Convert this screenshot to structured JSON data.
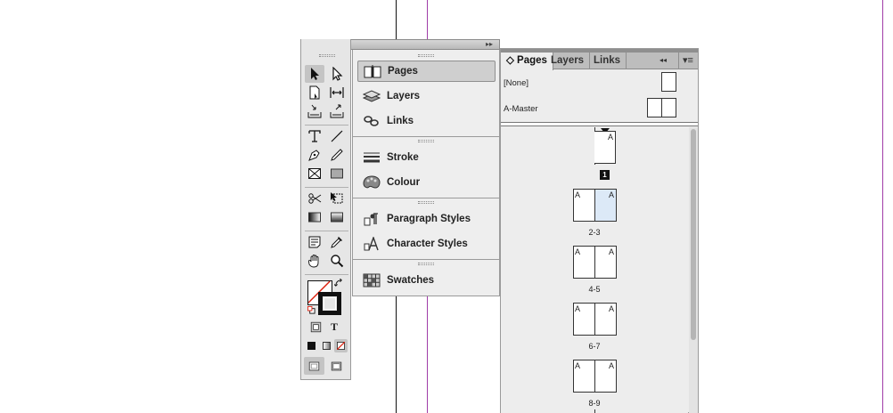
{
  "tools_panel": {
    "close_glyph": "×",
    "collapse_glyph": "◂◂",
    "expand_glyph": "▸▸",
    "tools": [
      {
        "name": "selection-tool-icon"
      },
      {
        "name": "direct-selection-tool-icon"
      },
      {
        "name": "page-tool-icon"
      },
      {
        "name": "gap-tool-icon"
      },
      {
        "name": "content-collector-icon"
      },
      {
        "name": "content-placer-icon"
      },
      {
        "name": "type-tool-icon"
      },
      {
        "name": "line-tool-icon"
      },
      {
        "name": "pen-tool-icon"
      },
      {
        "name": "pencil-tool-icon"
      },
      {
        "name": "rectangle-frame-tool-icon"
      },
      {
        "name": "rectangle-tool-icon"
      },
      {
        "name": "scissors-tool-icon"
      },
      {
        "name": "free-transform-tool-icon"
      },
      {
        "name": "gradient-swatch-tool-icon"
      },
      {
        "name": "gradient-feather-tool-icon"
      },
      {
        "name": "note-tool-icon"
      },
      {
        "name": "eyedropper-tool-icon"
      },
      {
        "name": "hand-tool-icon"
      },
      {
        "name": "zoom-tool-icon"
      }
    ],
    "text_fill_glyph": "T"
  },
  "panel_list": {
    "items": [
      {
        "label": "Pages",
        "icon": "pages-icon",
        "selected": true
      },
      {
        "label": "Layers",
        "icon": "layers-icon"
      },
      {
        "label": "Links",
        "icon": "links-icon"
      },
      {
        "label": "Stroke",
        "icon": "stroke-icon"
      },
      {
        "label": "Colour",
        "icon": "colour-palette-icon"
      },
      {
        "label": "Paragraph Styles",
        "icon": "paragraph-styles-icon"
      },
      {
        "label": "Character Styles",
        "icon": "character-styles-icon"
      },
      {
        "label": "Swatches",
        "icon": "swatches-icon"
      }
    ]
  },
  "pages_panel": {
    "tabs": [
      {
        "label": "◇ Pages",
        "active": true
      },
      {
        "label": "Layers"
      },
      {
        "label": "Links"
      }
    ],
    "collapse_glyph": "◂◂",
    "menu_glyph": "▾≡",
    "masters": [
      {
        "label": "[None]"
      },
      {
        "label": "A-Master"
      }
    ],
    "master_letter": "A",
    "first_page_number": "1",
    "spreads": [
      "2-3",
      "4-5",
      "6-7",
      "8-9"
    ]
  },
  "colors": {
    "guide_purple": "#a03ca8",
    "selected_page_fill": "#dce9f7"
  }
}
